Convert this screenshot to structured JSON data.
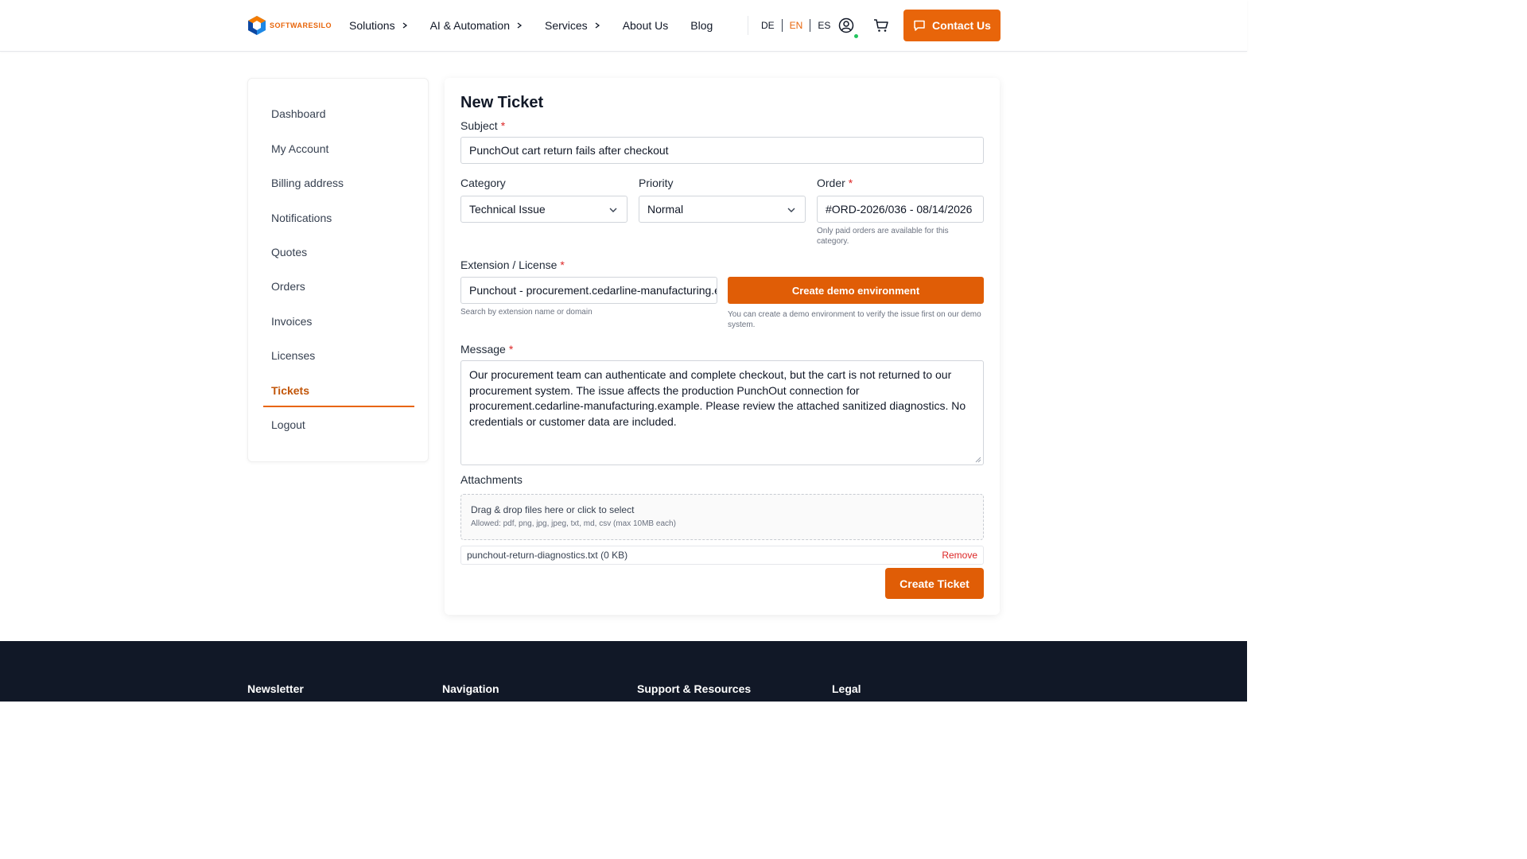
{
  "header": {
    "logo_text": "SOFTWARESILO",
    "nav": [
      {
        "label": "Solutions",
        "has_chevron": true
      },
      {
        "label": "AI & Automation",
        "has_chevron": true
      },
      {
        "label": "Services",
        "has_chevron": true
      },
      {
        "label": "About Us",
        "has_chevron": false
      },
      {
        "label": "Blog",
        "has_chevron": false
      }
    ],
    "languages": [
      "DE",
      "EN",
      "ES"
    ],
    "active_language": "EN",
    "contact_label": "Contact Us"
  },
  "sidebar": {
    "items": [
      "Dashboard",
      "My Account",
      "Billing address",
      "Notifications",
      "Quotes",
      "Orders",
      "Invoices",
      "Licenses",
      "Tickets",
      "Logout"
    ],
    "active": "Tickets"
  },
  "form": {
    "title": "New Ticket",
    "subject_label": "Subject",
    "subject_value": "PunchOut cart return fails after checkout",
    "category_label": "Category",
    "category_value": "Technical Issue",
    "priority_label": "Priority",
    "priority_value": "Normal",
    "order_label": "Order",
    "order_value": "#ORD-2026/036 - 08/14/2026",
    "order_hint": "Only paid orders are available for this category.",
    "extension_label": "Extension / License",
    "extension_value": "Punchout - procurement.cedarline-manufacturing.example",
    "extension_hint": "Search by extension name or domain",
    "demo_button": "Create demo environment",
    "demo_hint": "You can create a demo environment to verify the issue first on our demo system.",
    "message_label": "Message",
    "message_value": "Our procurement team can authenticate and complete checkout, but the cart is not returned to our procurement system. The issue affects the production PunchOut connection for procurement.cedarline-manufacturing.example. Please review the attached sanitized diagnostics. No credentials or customer data are included.",
    "attachments_label": "Attachments",
    "dropzone_text": "Drag & drop files here or click to select",
    "dropzone_allowed": "Allowed: pdf, png, jpg, jpeg, txt, md, csv (max 10MB each)",
    "attachment_file": "punchout-return-diagnostics.txt (0 KB)",
    "remove_label": "Remove",
    "submit_label": "Create Ticket",
    "required_mark": "*"
  },
  "footer": {
    "headings": [
      "Newsletter",
      "Navigation",
      "Support & Resources",
      "Legal"
    ]
  },
  "colors": {
    "accent": "#e8650a",
    "footer_bg": "#111827",
    "required": "#dc2626"
  }
}
